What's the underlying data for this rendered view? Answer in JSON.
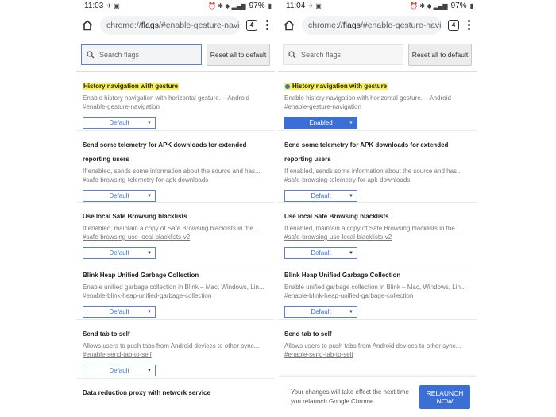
{
  "accent": "#3b6fd6",
  "left": {
    "time": "11:03",
    "battery": "97%",
    "url_prefix": "chrome://",
    "url_host": "flags",
    "url_rest": "/#enable-gesture-naviga",
    "tab_count": "4",
    "search_placeholder": "Search flags",
    "reset_label": "Reset all to default",
    "flags": [
      {
        "title": "History navigation with gesture",
        "desc": "Enable history navigation with horizontal gesture. – Android",
        "link": "#enable-gesture-navigation",
        "value": "Default"
      },
      {
        "title": "Send some telemetry for APK downloads for extended reporting users",
        "desc": "If enabled, sends some information about the source and has...",
        "link": "#safe-browsing-telemetry-for-apk-downloads",
        "value": "Default"
      },
      {
        "title": "Use local Safe Browsing blacklists",
        "desc": "If enabled, maintain a copy of Safe Browsing blacklists in the ...",
        "link": "#safe-browsing-use-local-blacklists-v2",
        "value": "Default"
      },
      {
        "title": "Blink Heap Unified Garbage Collection",
        "desc": "Enable unified garbage collection in Blink – Mac, Windows, Lin...",
        "link": "#enable-blink-heap-unified-garbage-collection",
        "value": "Default"
      },
      {
        "title": "Send tab to self",
        "desc": "Allows users to push tabs from Android devices to other sync...",
        "link": "#enable-send-tab-to-self",
        "value": "Default"
      },
      {
        "title": "Data reduction proxy with network service",
        "desc": "",
        "link": "",
        "value": ""
      }
    ]
  },
  "right": {
    "time": "11:04",
    "battery": "97%",
    "url_prefix": "chrome://",
    "url_host": "flags",
    "url_rest": "/#enable-gesture-naviga",
    "tab_count": "4",
    "search_placeholder": "Search flags",
    "reset_label": "Reset all to default",
    "flags": [
      {
        "title": "History navigation with gesture",
        "desc": "Enable history navigation with horizontal gesture. – Android",
        "link": "#enable-gesture-navigation",
        "value": "Enabled"
      },
      {
        "title": "Send some telemetry for APK downloads for extended reporting users",
        "desc": "If enabled, sends some information about the source and has...",
        "link": "#safe-browsing-telemetry-for-apk-downloads",
        "value": "Default"
      },
      {
        "title": "Use local Safe Browsing blacklists",
        "desc": "If enabled, maintain a copy of Safe Browsing blacklists in the ...",
        "link": "#safe-browsing-use-local-blacklists-v2",
        "value": "Default"
      },
      {
        "title": "Blink Heap Unified Garbage Collection",
        "desc": "Enable unified garbage collection in Blink – Mac, Windows, Lin...",
        "link": "#enable-blink-heap-unified-garbage-collection",
        "value": "Default"
      },
      {
        "title": "Send tab to self",
        "desc": "Allows users to push tabs from Android devices to other sync...",
        "link": "#enable-send-tab-to-self",
        "value": "Default"
      }
    ],
    "snackbar_text": "Your changes will take effect the next time you relaunch Google Chrome.",
    "relaunch_label": "RELAUNCH NOW"
  }
}
